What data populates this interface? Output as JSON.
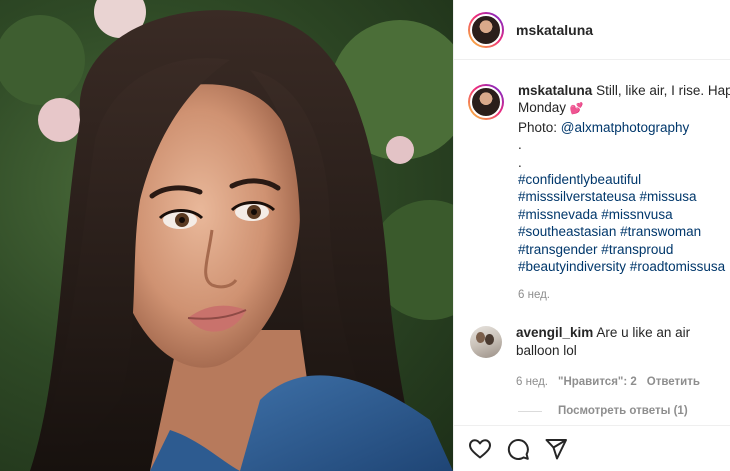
{
  "post": {
    "image_alt": "portrait photo"
  },
  "header": {
    "username": "mskataluna"
  },
  "caption": {
    "username": "mskataluna",
    "line1": "Still, like air, I rise. Happy",
    "line2": "Monday",
    "heart": "💕",
    "photo_label": "Photo: ",
    "mention": "@alxmatphotography",
    "dot1": ".",
    "dot2": ".",
    "tags": [
      "#confidentlybeautiful",
      "#misssilverstateusa #missusa",
      "#missnevada #missnvusa",
      "#southeastasian #transwoman",
      "#transgender #transproud",
      "#beautyindiversity #roadtomissusa"
    ],
    "time": "6 нед."
  },
  "comment": {
    "username": "avengil_kim",
    "text": "Are u like an air balloon lol",
    "time": "6 нед.",
    "likes": "\"Нравится\": 2",
    "reply": "Ответить",
    "view_replies": "Посмотреть ответы (1)"
  },
  "icons": [
    "heart-icon",
    "comment-icon",
    "share-icon"
  ]
}
